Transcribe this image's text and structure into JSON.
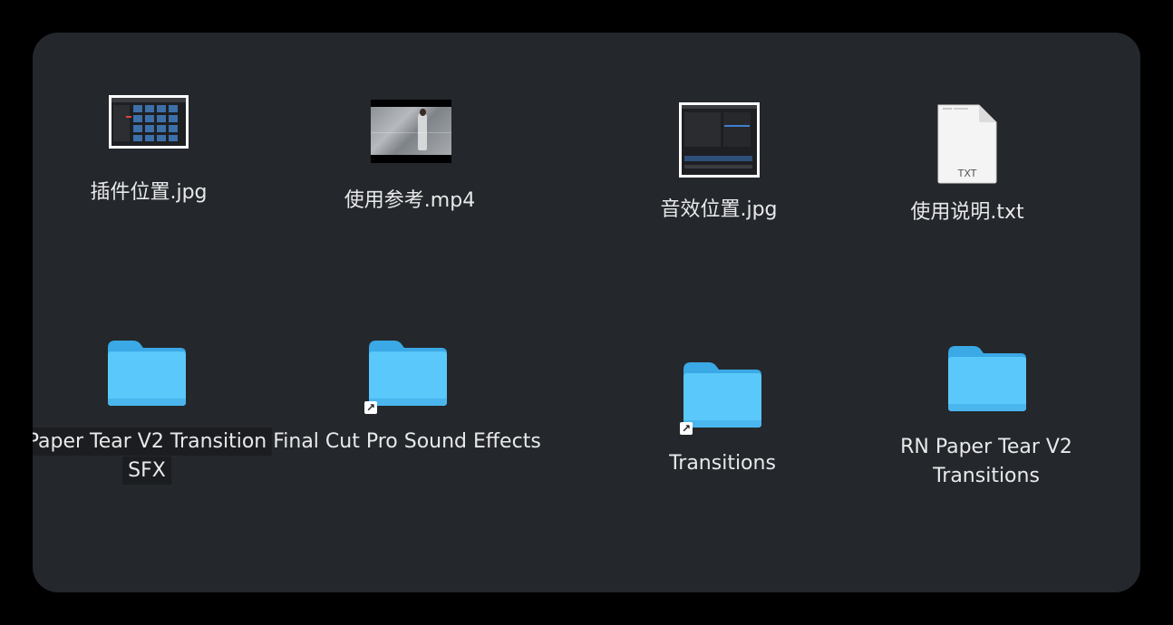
{
  "colors": {
    "window_bg": "#24272b",
    "folder_body": "#5ac8fa",
    "folder_tab": "#3fb0ea",
    "label_text": "#e8e9ea"
  },
  "items": {
    "plugin_location": {
      "name": "插件位置.jpg",
      "icon": "image-thumbnail-icon"
    },
    "usage_reference": {
      "name": "使用参考.mp4",
      "icon": "video-thumbnail-icon"
    },
    "sfx_location": {
      "name": "音效位置.jpg",
      "icon": "image-thumbnail-icon"
    },
    "usage_instructions": {
      "name": "使用说明.txt",
      "icon": "text-document-icon",
      "badge": "TXT"
    },
    "paper_tear_sfx": {
      "name_line1": "Paper Tear V2 Transition",
      "name_line2": "SFX",
      "icon": "folder-icon"
    },
    "fcp_sound_effects": {
      "name": "Final Cut Pro Sound Effects",
      "icon": "folder-alias-icon"
    },
    "transitions": {
      "name": "Transitions",
      "icon": "folder-alias-icon"
    },
    "rn_paper_tear": {
      "name_line1": "RN Paper Tear V2",
      "name_line2": "Transitions",
      "icon": "folder-icon"
    }
  }
}
